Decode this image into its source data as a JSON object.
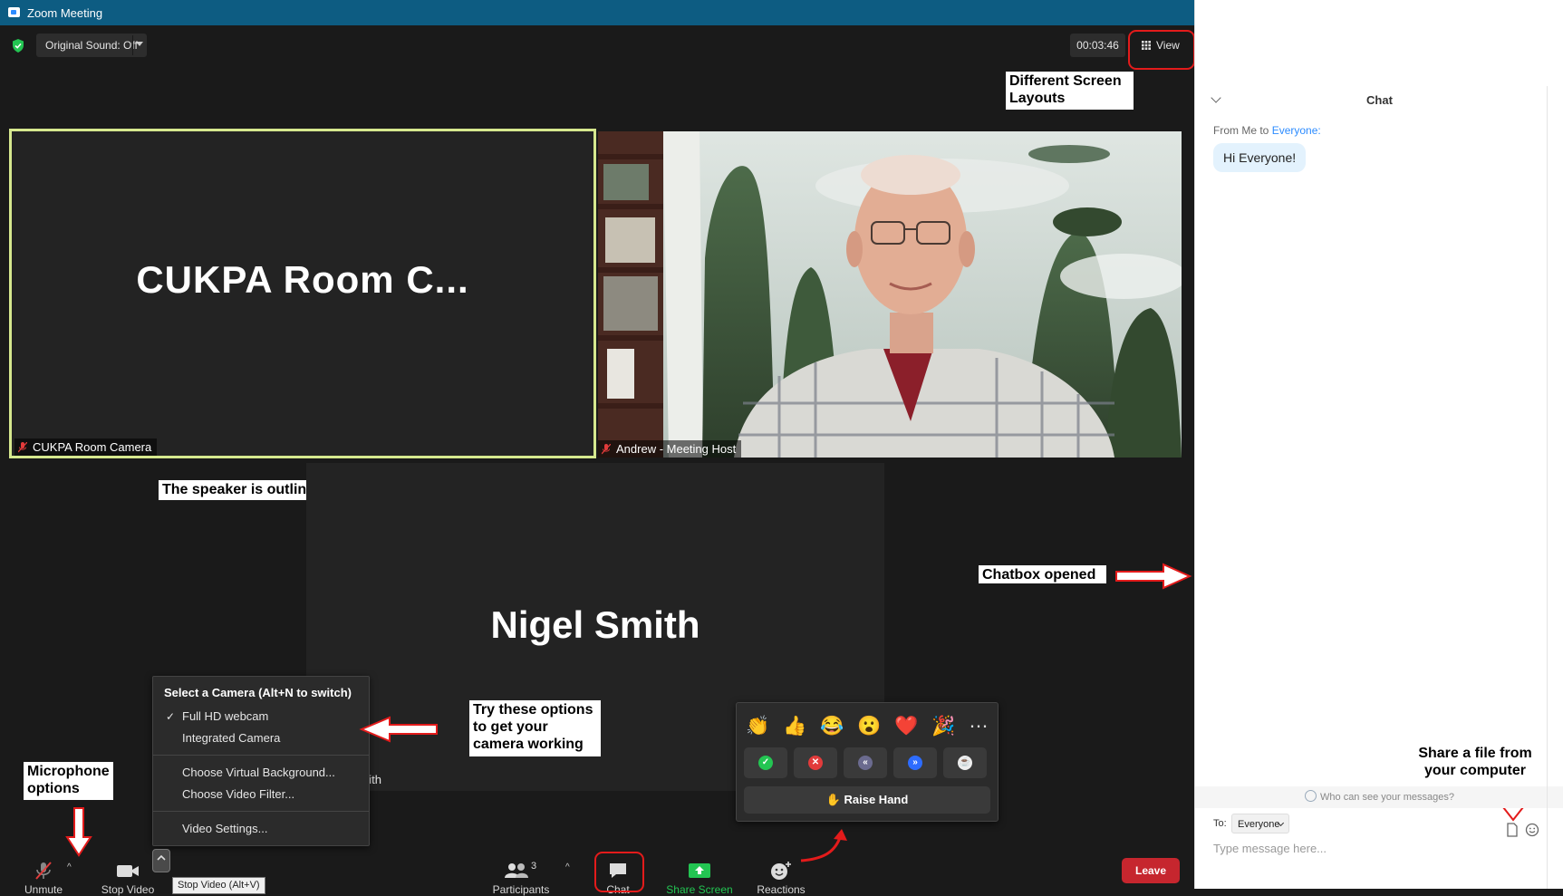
{
  "window": {
    "title": "Zoom Meeting"
  },
  "topbar": {
    "original_sound": "Original Sound: Off",
    "timer": "00:03:46",
    "view_label": "View"
  },
  "tiles": {
    "room_camera": {
      "big_name": "CUKPA Room C...",
      "label": "CUKPA Room Camera"
    },
    "host": {
      "label": "Andrew - Meeting Host"
    },
    "nigel": {
      "big_name": "Nigel Smith",
      "label_partial": "nith"
    }
  },
  "camera_menu": {
    "header": "Select a Camera (Alt+N to switch)",
    "items": [
      "Full HD webcam",
      "Integrated Camera"
    ],
    "selected": "Full HD webcam",
    "extra": [
      "Choose Virtual Background...",
      "Choose Video Filter..."
    ],
    "settings": "Video Settings..."
  },
  "reactions": {
    "emojis": [
      "👏",
      "👍",
      "😂",
      "😮",
      "❤️",
      "🎉",
      "⋯"
    ],
    "raise_hand": "Raise Hand",
    "raise_icon": "✋"
  },
  "toolbar": {
    "unmute": "Unmute",
    "stop_video": "Stop Video",
    "tooltip": "Stop Video (Alt+V)",
    "participants": "Participants",
    "participants_count": "3",
    "chat": "Chat",
    "share_screen": "Share Screen",
    "reactions": "Reactions",
    "leave": "Leave"
  },
  "chat": {
    "title": "Chat",
    "from_prefix": "From Me to ",
    "from_target": "Everyone:",
    "message": "Hi Everyone!",
    "who_can_see": "Who can see your messages?",
    "to_label": "To:",
    "to_value": "Everyone",
    "input_placeholder": "Type message here..."
  },
  "annotations": {
    "layouts": "Different Screen Layouts",
    "speaker": "The speaker is outlined",
    "chatbox": "Chatbox opened",
    "camera": "Try these options to get your camera working",
    "mic": "Microphone options",
    "share_file": "Share a file from your computer"
  },
  "colors": {
    "titlebar": "#0d5c82",
    "speaker_outline": "#d6e88e",
    "annotation_red": "#e31b1b",
    "leave": "#c6262e",
    "chat_accent": "#2d8cff",
    "share_green": "#22c55e"
  }
}
